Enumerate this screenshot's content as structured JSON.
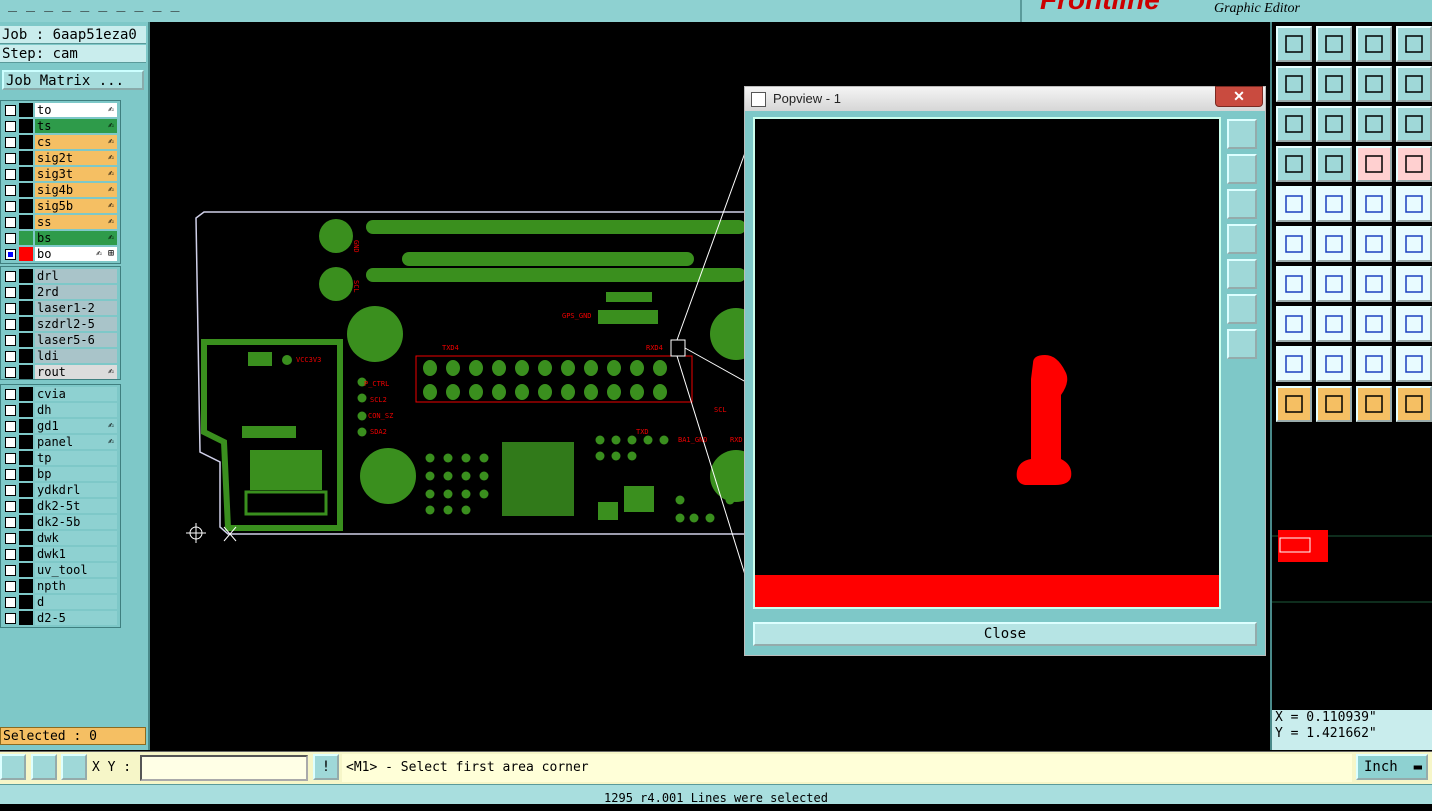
{
  "app": {
    "window_title": "_  _  _ _    _  _  _ _    _  _  ",
    "brand_logo": "Frontline",
    "brand_sub": "Graphic Editor"
  },
  "job": {
    "job_line": "Job : 6aap51eza0",
    "step_line": "Step: cam",
    "matrix_button": "Job Matrix ..."
  },
  "layers_signal": [
    {
      "name": "to",
      "color": "#ffffff",
      "swatch": "#000000",
      "checked": false,
      "mark": "✍"
    },
    {
      "name": "ts",
      "color": "#2e9b4a",
      "swatch": "#000000",
      "checked": false,
      "mark": "✍"
    },
    {
      "name": "cs",
      "color": "#f5bf63",
      "swatch": "#000000",
      "checked": false,
      "mark": "✍"
    },
    {
      "name": "sig2t",
      "color": "#f5bf63",
      "swatch": "#000000",
      "checked": false,
      "mark": "✍"
    },
    {
      "name": "sig3t",
      "color": "#f5bf63",
      "swatch": "#000000",
      "checked": false,
      "mark": "✍"
    },
    {
      "name": "sig4b",
      "color": "#f5bf63",
      "swatch": "#000000",
      "checked": false,
      "mark": "✍"
    },
    {
      "name": "sig5b",
      "color": "#f5bf63",
      "swatch": "#000000",
      "checked": false,
      "mark": "✍"
    },
    {
      "name": "ss",
      "color": "#f5bf63",
      "swatch": "#000000",
      "checked": false,
      "mark": "✍"
    },
    {
      "name": "bs",
      "color": "#2e9b4a",
      "swatch": "#2e9b4a",
      "checked": false,
      "mark": "✍"
    },
    {
      "name": "bo",
      "color": "#ffffff",
      "swatch": "#ff0000",
      "checked": true,
      "mark": "✍ ⊞"
    }
  ],
  "layers_drill": [
    {
      "name": "drl",
      "color": "#a9c4c9",
      "swatch": "#000000",
      "checked": false,
      "mark": ""
    },
    {
      "name": "2rd",
      "color": "#a9c4c9",
      "swatch": "#000000",
      "checked": false,
      "mark": ""
    },
    {
      "name": "laser1-2",
      "color": "#a9c4c9",
      "swatch": "#000000",
      "checked": false,
      "mark": ""
    },
    {
      "name": "szdrl2-5",
      "color": "#a9c4c9",
      "swatch": "#000000",
      "checked": false,
      "mark": ""
    },
    {
      "name": "laser5-6",
      "color": "#a9c4c9",
      "swatch": "#000000",
      "checked": false,
      "mark": ""
    },
    {
      "name": "ldi",
      "color": "#a9c4c9",
      "swatch": "#000000",
      "checked": false,
      "mark": ""
    },
    {
      "name": "rout",
      "color": "#dcdcdc",
      "swatch": "#000000",
      "checked": false,
      "mark": "✍"
    }
  ],
  "layers_misc": [
    {
      "name": "cvia",
      "color": "#8ed1d1",
      "swatch": "#000000",
      "checked": false,
      "mark": ""
    },
    {
      "name": "dh",
      "color": "#8ed1d1",
      "swatch": "#000000",
      "checked": false,
      "mark": ""
    },
    {
      "name": "gd1",
      "color": "#8ed1d1",
      "swatch": "#000000",
      "checked": false,
      "mark": "✍"
    },
    {
      "name": "panel",
      "color": "#8ed1d1",
      "swatch": "#000000",
      "checked": false,
      "mark": "✍"
    },
    {
      "name": "tp",
      "color": "#8ed1d1",
      "swatch": "#000000",
      "checked": false,
      "mark": ""
    },
    {
      "name": "bp",
      "color": "#8ed1d1",
      "swatch": "#000000",
      "checked": false,
      "mark": ""
    },
    {
      "name": "ydkdrl",
      "color": "#8ed1d1",
      "swatch": "#000000",
      "checked": false,
      "mark": ""
    },
    {
      "name": "dk2-5t",
      "color": "#8ed1d1",
      "swatch": "#000000",
      "checked": false,
      "mark": ""
    },
    {
      "name": "dk2-5b",
      "color": "#8ed1d1",
      "swatch": "#000000",
      "checked": false,
      "mark": ""
    },
    {
      "name": "dwk",
      "color": "#8ed1d1",
      "swatch": "#000000",
      "checked": false,
      "mark": ""
    },
    {
      "name": "dwk1",
      "color": "#8ed1d1",
      "swatch": "#000000",
      "checked": false,
      "mark": ""
    },
    {
      "name": "uv_tool",
      "color": "#8ed1d1",
      "swatch": "#000000",
      "checked": false,
      "mark": ""
    },
    {
      "name": "npth",
      "color": "#8ed1d1",
      "swatch": "#000000",
      "checked": false,
      "mark": ""
    },
    {
      "name": "d",
      "color": "#8ed1d1",
      "swatch": "#000000",
      "checked": false,
      "mark": ""
    },
    {
      "name": "d2-5",
      "color": "#8ed1d1",
      "swatch": "#000000",
      "checked": false,
      "mark": ""
    }
  ],
  "selected": "Selected : 0",
  "pcb_labels": {
    "gnd": "GND",
    "scl": "SCL",
    "gps_gnd": "GPS_GND",
    "txd4": "TXD4",
    "rxd4": "RXD4",
    "p_ctrl": "P_CTRL",
    "scl2": "SCL2",
    "con_sz": "CON_SZ",
    "sda2": "SDA2",
    "vcc3v3": "VCC3V3",
    "scl_r": "SCL",
    "rxd_r": "RXD",
    "ba1_gnd": "BA1_GND",
    "txd_r": "TXD"
  },
  "popview": {
    "title": "Popview - 1",
    "close_x": "✕",
    "close": "Close"
  },
  "coords": {
    "x": "X = 0.110939\"",
    "y": "Y = 1.421662\""
  },
  "bottom": {
    "xy_label": "X Y :",
    "xy_value": "",
    "excl": "!",
    "prompt": "<M1> - Select first area corner",
    "units": "Inch",
    "status": "1295 r4.001 Lines were selected"
  },
  "colors": {
    "teal": "#8ed1d1",
    "pcb_green": "#3a8f1e",
    "red": "#ff0000",
    "orange": "#f5bf63"
  },
  "icons": [
    "zoom-home-icon",
    "zoom-in-icon",
    "zoom-out-icon",
    "grid-icon",
    "measure-icon",
    "select-icon",
    "cursor-icon"
  ]
}
